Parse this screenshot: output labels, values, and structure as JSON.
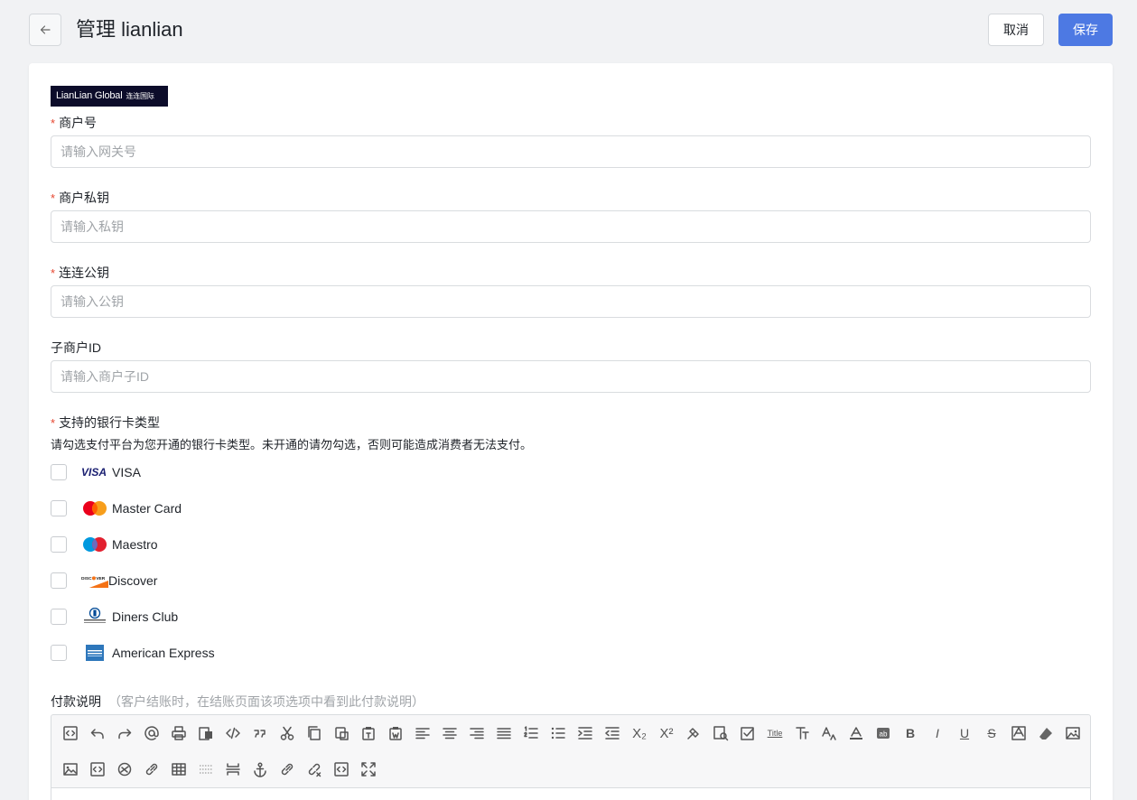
{
  "header": {
    "title": "管理 lianlian",
    "cancel_label": "取消",
    "save_label": "保存"
  },
  "logo": {
    "text": "LianLian Global",
    "text_cn": "连连国际"
  },
  "fields": [
    {
      "label": "商户号",
      "required": true,
      "placeholder": "请输入网关号",
      "value": ""
    },
    {
      "label": "商户私钥",
      "required": true,
      "placeholder": "请输入私钥",
      "value": ""
    },
    {
      "label": "连连公钥",
      "required": true,
      "placeholder": "请输入公钥",
      "value": ""
    },
    {
      "label": "子商户ID",
      "required": false,
      "placeholder": "请输入商户子ID",
      "value": ""
    }
  ],
  "card_types": {
    "label": "支持的银行卡类型",
    "required": true,
    "hint": "请勾选支付平台为您开通的银行卡类型。未开通的请勿勾选，否则可能造成消费者无法支付。",
    "options": [
      {
        "name": "VISA",
        "icon": "visa-logo",
        "checked": false
      },
      {
        "name": "Master Card",
        "icon": "mastercard-logo",
        "checked": false
      },
      {
        "name": "Maestro",
        "icon": "maestro-logo",
        "checked": false
      },
      {
        "name": "Discover",
        "icon": "discover-logo",
        "checked": false
      },
      {
        "name": "Diners Club",
        "icon": "diners-club-logo",
        "checked": false
      },
      {
        "name": "American Express",
        "icon": "amex-logo",
        "checked": false
      }
    ]
  },
  "payment_note": {
    "label": "付款说明",
    "note": "（客户结账时，在结账页面该项选项中看到此付款说明）"
  },
  "editor": {
    "toolbar_row1": [
      "source-code",
      "undo",
      "redo",
      "mention",
      "print",
      "paste-word",
      "code",
      "blockquote",
      "cut",
      "copy",
      "paste",
      "paste-text",
      "paste-from-word",
      "align-left",
      "align-center",
      "align-right",
      "align-justify",
      "ordered-list",
      "bullet-list",
      "indent",
      "outdent",
      "subscript",
      "superscript",
      "format-painter",
      "select-all",
      "check",
      "title",
      "font-family",
      "font-size",
      "font-color",
      "highlight",
      "bold",
      "italic",
      "underline",
      "strikethrough",
      "text-background",
      "eraser",
      "image"
    ],
    "toolbar_row2": [
      "multi-image",
      "media",
      "flash",
      "link",
      "table",
      "horizontal-rule",
      "page-break",
      "anchor",
      "link-2",
      "unlink",
      "html",
      "fullscreen"
    ],
    "toolbar_text": {
      "subscript": "X₂",
      "superscript": "X²",
      "title": "Title",
      "bold": "B",
      "italic": "I",
      "underline": "U",
      "strikethrough": "S"
    }
  },
  "colors": {
    "primary": "#4d79e3",
    "required": "#e6462f",
    "background": "#f1f2f4",
    "logo_bg": "#0c0c2a"
  }
}
